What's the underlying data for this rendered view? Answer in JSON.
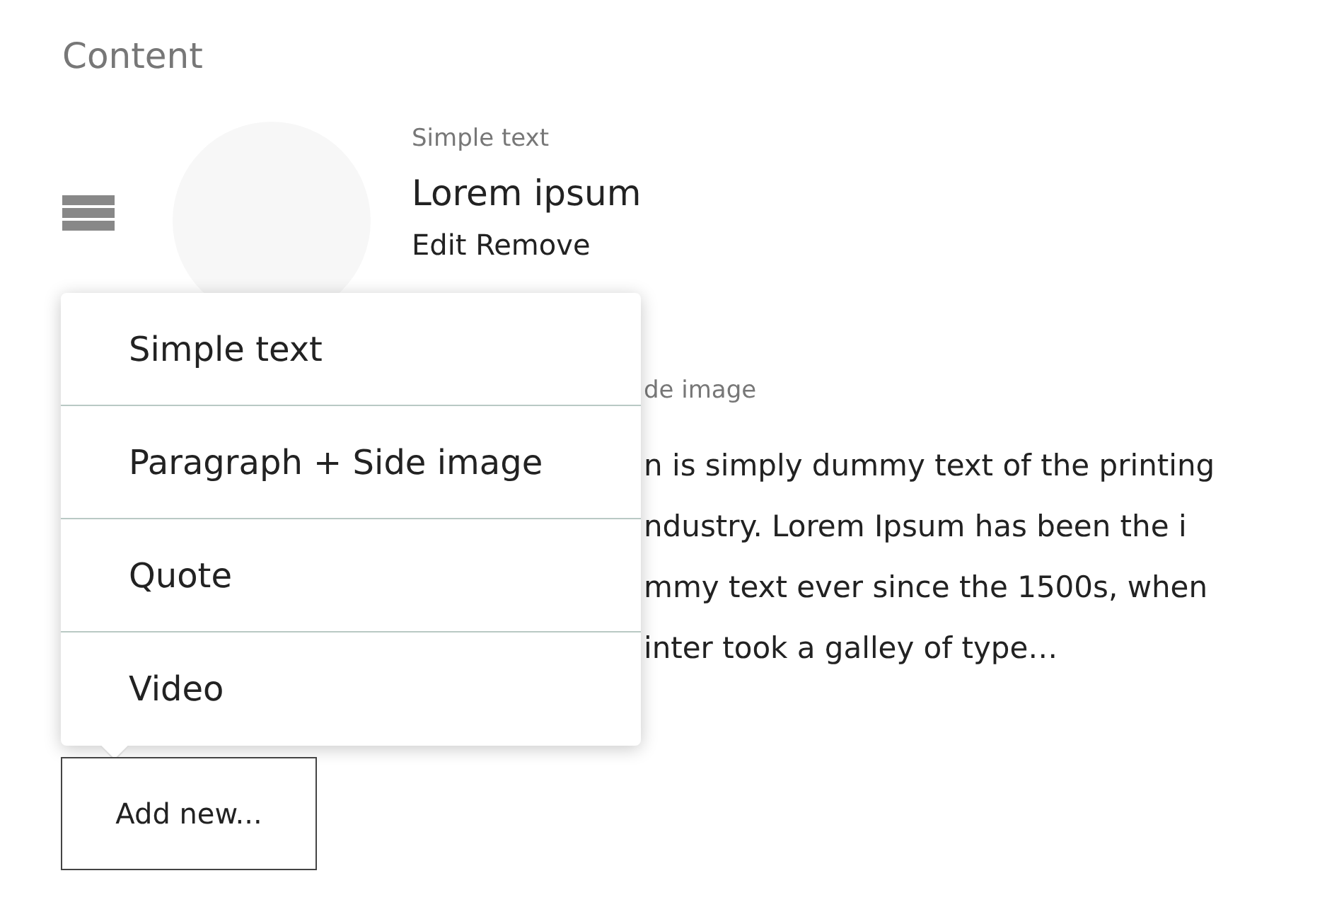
{
  "heading": "Content",
  "items": [
    {
      "type": "Simple text",
      "title": "Lorem ipsum",
      "actions": "Edit Remove"
    },
    {
      "type": "de image",
      "body": [
        "n is simply dummy text of the printing",
        "ndustry. Lorem Ipsum has been the i",
        "mmy text ever since the 1500s, when",
        "inter took a galley of type…"
      ]
    }
  ],
  "menu": {
    "expanded": true,
    "options": [
      "Simple text",
      "Paragraph + Side image",
      "Quote",
      "Video"
    ]
  },
  "add_button": "Add new..."
}
